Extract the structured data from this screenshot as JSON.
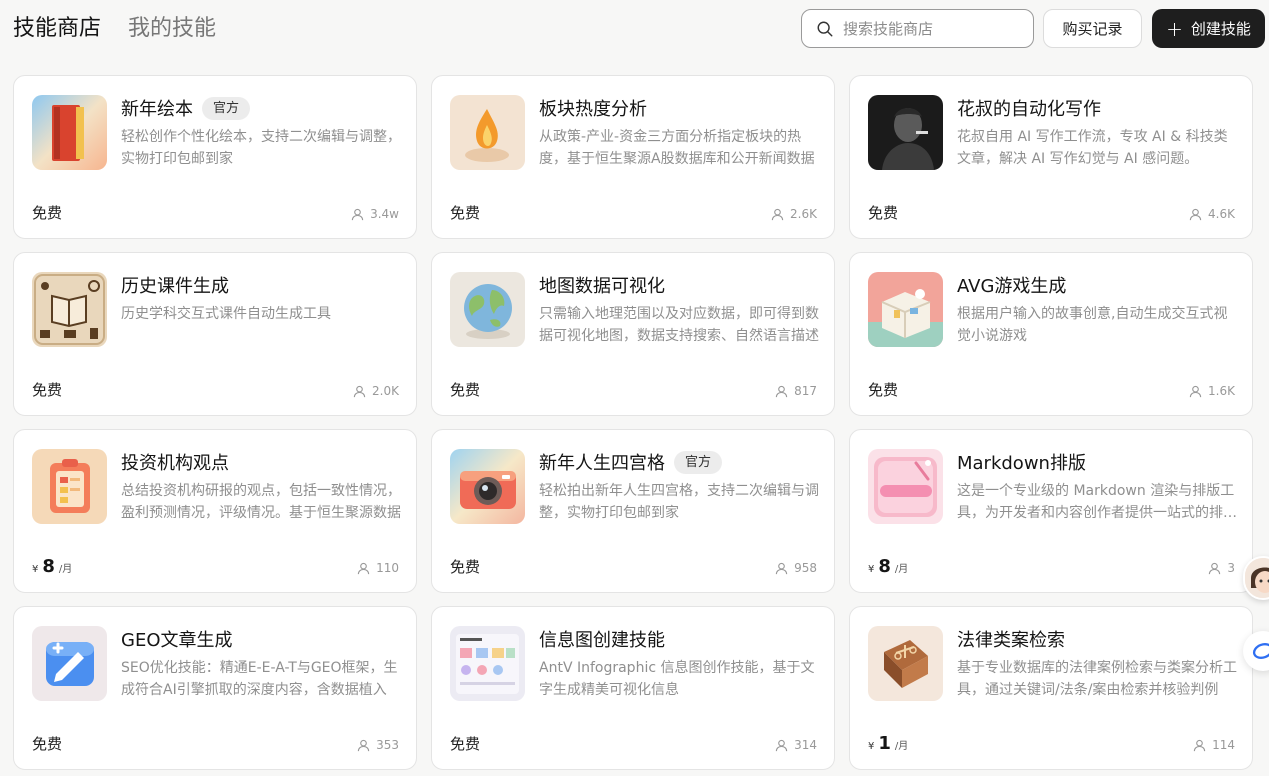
{
  "tabs": {
    "store": "技能商店",
    "mine": "我的技能"
  },
  "search": {
    "placeholder": "搜索技能商店"
  },
  "buttons": {
    "purchase": "购买记录",
    "create": "创建技能"
  },
  "colors": {
    "primary_button": "#1e1e1e",
    "badge_bg": "#ececec",
    "desc_text": "#8f8f8f"
  },
  "cards": [
    {
      "title": "新年绘本",
      "badge": "官方",
      "desc": "轻松创作个性化绘本，支持二次编辑与调整，实物打印包邮到家",
      "price_free": "免费",
      "users": "3.4w",
      "icon": "picture-book-icon"
    },
    {
      "title": "板块热度分析",
      "badge": "",
      "desc": "从政策-产业-资金三方面分析指定板块的热度，基于恒生聚源A股数据库和公开新闻数据",
      "price_free": "免费",
      "users": "2.6K",
      "icon": "flame-icon"
    },
    {
      "title": "花叔的自动化写作",
      "badge": "",
      "desc": "花叔自用 AI 写作工作流，专攻 AI & 科技类文章，解决 AI 写作幻觉与 AI 感问题。",
      "price_free": "免费",
      "users": "4.6K",
      "icon": "portrait-icon"
    },
    {
      "title": "历史课件生成",
      "badge": "",
      "desc": "历史学科交互式课件自动生成工具",
      "price_free": "免费",
      "users": "2.0K",
      "icon": "history-book-icon"
    },
    {
      "title": "地图数据可视化",
      "badge": "",
      "desc": "只需输入地理范围以及对应数据，即可得到数据可视化地图，数据支持搜索、自然语言描述",
      "price_free": "免费",
      "users": "817",
      "icon": "globe-icon"
    },
    {
      "title": "AVG游戏生成",
      "badge": "",
      "desc": "根据用户输入的故事创意,自动生成交互式视觉小说游戏",
      "price_free": "免费",
      "users": "1.6K",
      "icon": "game-scene-icon"
    },
    {
      "title": "投资机构观点",
      "badge": "",
      "desc": "总结投资机构研报的观点，包括一致性情况，盈利预测情况，评级情况。基于恒生聚源数据",
      "price_free": "",
      "price_currency": "¥",
      "price_amount": "8",
      "price_unit": "/月",
      "users": "110",
      "icon": "clipboard-icon"
    },
    {
      "title": "新年人生四宫格",
      "badge": "官方",
      "desc": "轻松拍出新年人生四宫格，支持二次编辑与调整，实物打印包邮到家",
      "price_free": "免费",
      "users": "958",
      "icon": "camera-icon"
    },
    {
      "title": "Markdown排版",
      "badge": "",
      "desc": "这是一个专业级的 Markdown 渲染与排版工具，为开发者和内容创作者提供一站式的排版方案",
      "price_free": "",
      "price_currency": "¥",
      "price_amount": "8",
      "price_unit": "/月",
      "users": "3",
      "icon": "markdown-icon"
    },
    {
      "title": "GEO文章生成",
      "badge": "",
      "desc": "SEO优化技能：精通E-E-A-T与GEO框架，生成符合AI引擎抓取的深度内容，含数据植入",
      "price_free": "免费",
      "users": "353",
      "icon": "edit-card-icon"
    },
    {
      "title": "信息图创建技能",
      "badge": "",
      "desc": "AntV Infographic 信息图创作技能，基于文字生成精美可视化信息",
      "price_free": "免费",
      "users": "314",
      "icon": "infographic-icon"
    },
    {
      "title": "法律类案检索",
      "badge": "",
      "desc": "基于专业数据库的法律案例检索与类案分析工具，通过关键词/法条/案由检索并核验判例",
      "price_free": "",
      "price_currency": "¥",
      "price_amount": "1",
      "price_unit": "/月",
      "users": "114",
      "icon": "law-book-icon"
    }
  ]
}
